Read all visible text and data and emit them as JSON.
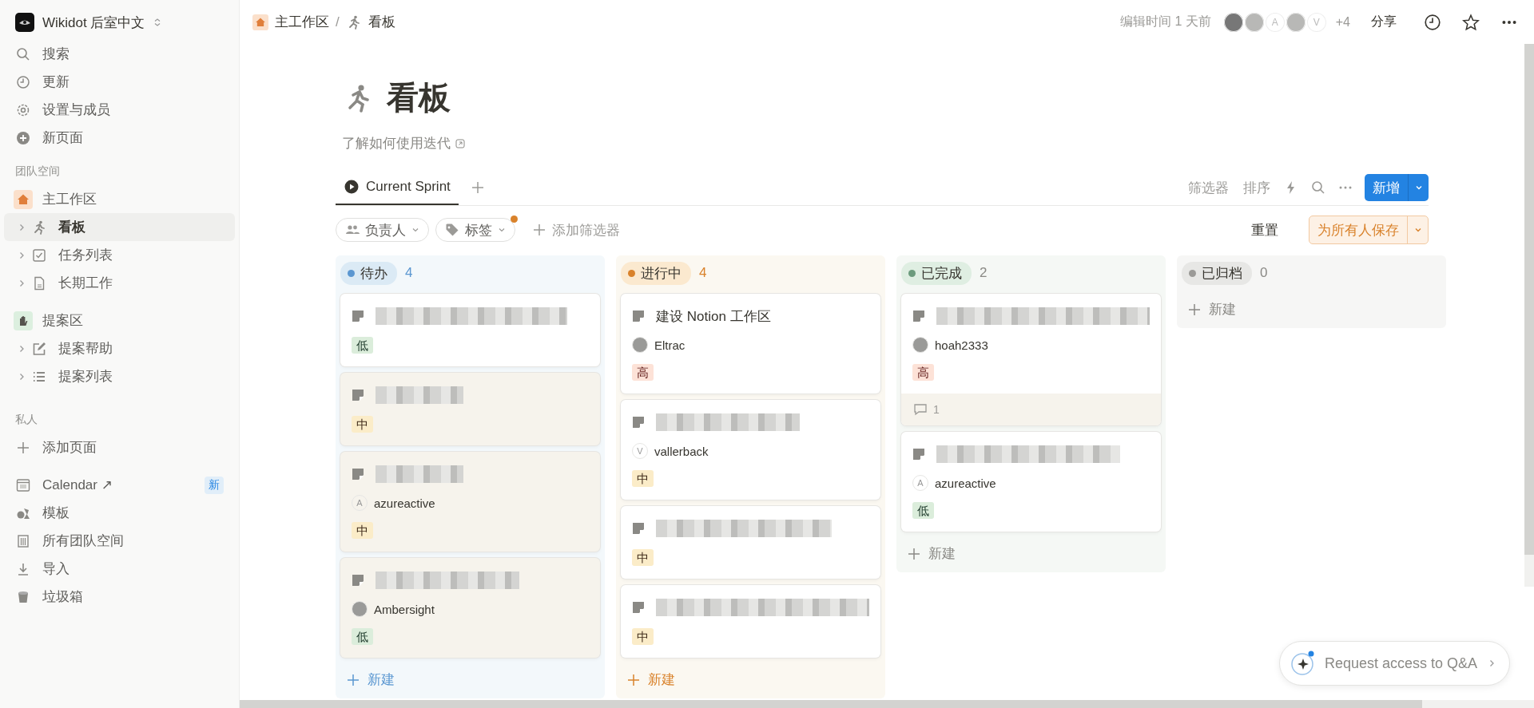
{
  "workspace": {
    "name": "Wikidot 后室中文"
  },
  "sidebar": {
    "nav": [
      {
        "label": "搜索"
      },
      {
        "label": "更新"
      },
      {
        "label": "设置与成员"
      },
      {
        "label": "新页面"
      }
    ],
    "teamspaces_heading": "团队空间",
    "teamspaces": [
      {
        "label": "主工作区",
        "children": [
          {
            "label": "看板",
            "selected": true
          },
          {
            "label": "任务列表",
            "selected": false
          },
          {
            "label": "长期工作",
            "selected": false
          }
        ]
      },
      {
        "label": "提案区",
        "children": [
          {
            "label": "提案帮助",
            "selected": false
          },
          {
            "label": "提案列表",
            "selected": false
          }
        ]
      }
    ],
    "private_heading": "私人",
    "add_page": "添加页面",
    "bottom": [
      {
        "label": "Calendar ↗",
        "badge": "新"
      },
      {
        "label": "模板"
      },
      {
        "label": "所有团队空间"
      },
      {
        "label": "导入"
      },
      {
        "label": "垃圾箱"
      }
    ]
  },
  "topbar": {
    "breadcrumbs": [
      {
        "label": "主工作区"
      },
      {
        "label": "看板"
      }
    ],
    "separator": "/",
    "edited": "编辑时间 1 天前",
    "avatars": [
      {
        "kind": "photo"
      },
      {
        "kind": "photo"
      },
      {
        "kind": "letter",
        "letter": "A"
      },
      {
        "kind": "photo"
      },
      {
        "kind": "letter",
        "letter": "V"
      }
    ],
    "more": "+4",
    "share": "分享"
  },
  "page": {
    "title": "看板",
    "link": "了解如何使用迭代"
  },
  "views": [
    {
      "label": "Current Sprint",
      "selected": true
    }
  ],
  "toolbar": {
    "filter": "筛选器",
    "sort": "排序",
    "new": "新增"
  },
  "filters": [
    {
      "label": "负责人",
      "active": false
    },
    {
      "label": "标签",
      "active": true
    }
  ],
  "add_filter": "添加筛选器",
  "reset": "重置",
  "save": "为所有人保存",
  "columns": [
    {
      "name": "待办",
      "count": "4",
      "kind": "todo",
      "color": "#5b97d1",
      "new": "新建",
      "cards": [
        {
          "selected": false,
          "priority": {
            "label": "低",
            "kind": "low"
          }
        },
        {
          "selected": true,
          "priority": {
            "label": "中",
            "kind": "mid"
          }
        },
        {
          "selected": true,
          "assignee": {
            "kind": "letter",
            "letter": "A",
            "name": "azureactive"
          },
          "priority": {
            "label": "中",
            "kind": "mid"
          }
        },
        {
          "selected": true,
          "assignee": {
            "kind": "photo",
            "name": "Ambersight"
          },
          "priority": {
            "label": "低",
            "kind": "low"
          }
        }
      ]
    },
    {
      "name": "进行中",
      "count": "4",
      "kind": "doing",
      "color": "#d9822b",
      "new": "新建",
      "cards": [
        {
          "selected": false,
          "title": "建设 Notion 工作区",
          "assignee": {
            "kind": "photo",
            "name": "Eltrac"
          },
          "priority": {
            "label": "高",
            "kind": "high"
          }
        },
        {
          "selected": false,
          "assignee": {
            "kind": "letter",
            "letter": "V",
            "name": "vallerback"
          },
          "priority": {
            "label": "中",
            "kind": "mid"
          }
        },
        {
          "selected": false,
          "priority": {
            "label": "中",
            "kind": "mid"
          }
        },
        {
          "selected": false,
          "priority": {
            "label": "中",
            "kind": "mid"
          }
        }
      ]
    },
    {
      "name": "已完成",
      "count": "2",
      "kind": "done",
      "color": "#6c9b7d",
      "new": "新建",
      "cards": [
        {
          "selected": false,
          "assignee": {
            "kind": "photo",
            "name": "hoah2333"
          },
          "priority": {
            "label": "高",
            "kind": "high"
          },
          "comments": "1"
        },
        {
          "selected": false,
          "assignee": {
            "kind": "letter",
            "letter": "A",
            "name": "azureactive"
          },
          "priority": {
            "label": "低",
            "kind": "low"
          }
        }
      ]
    },
    {
      "name": "已归档",
      "count": "0",
      "kind": "archived",
      "color": "#9b9a97",
      "new": "新建"
    }
  ],
  "assistant": {
    "label": "Request access to Q&A"
  }
}
